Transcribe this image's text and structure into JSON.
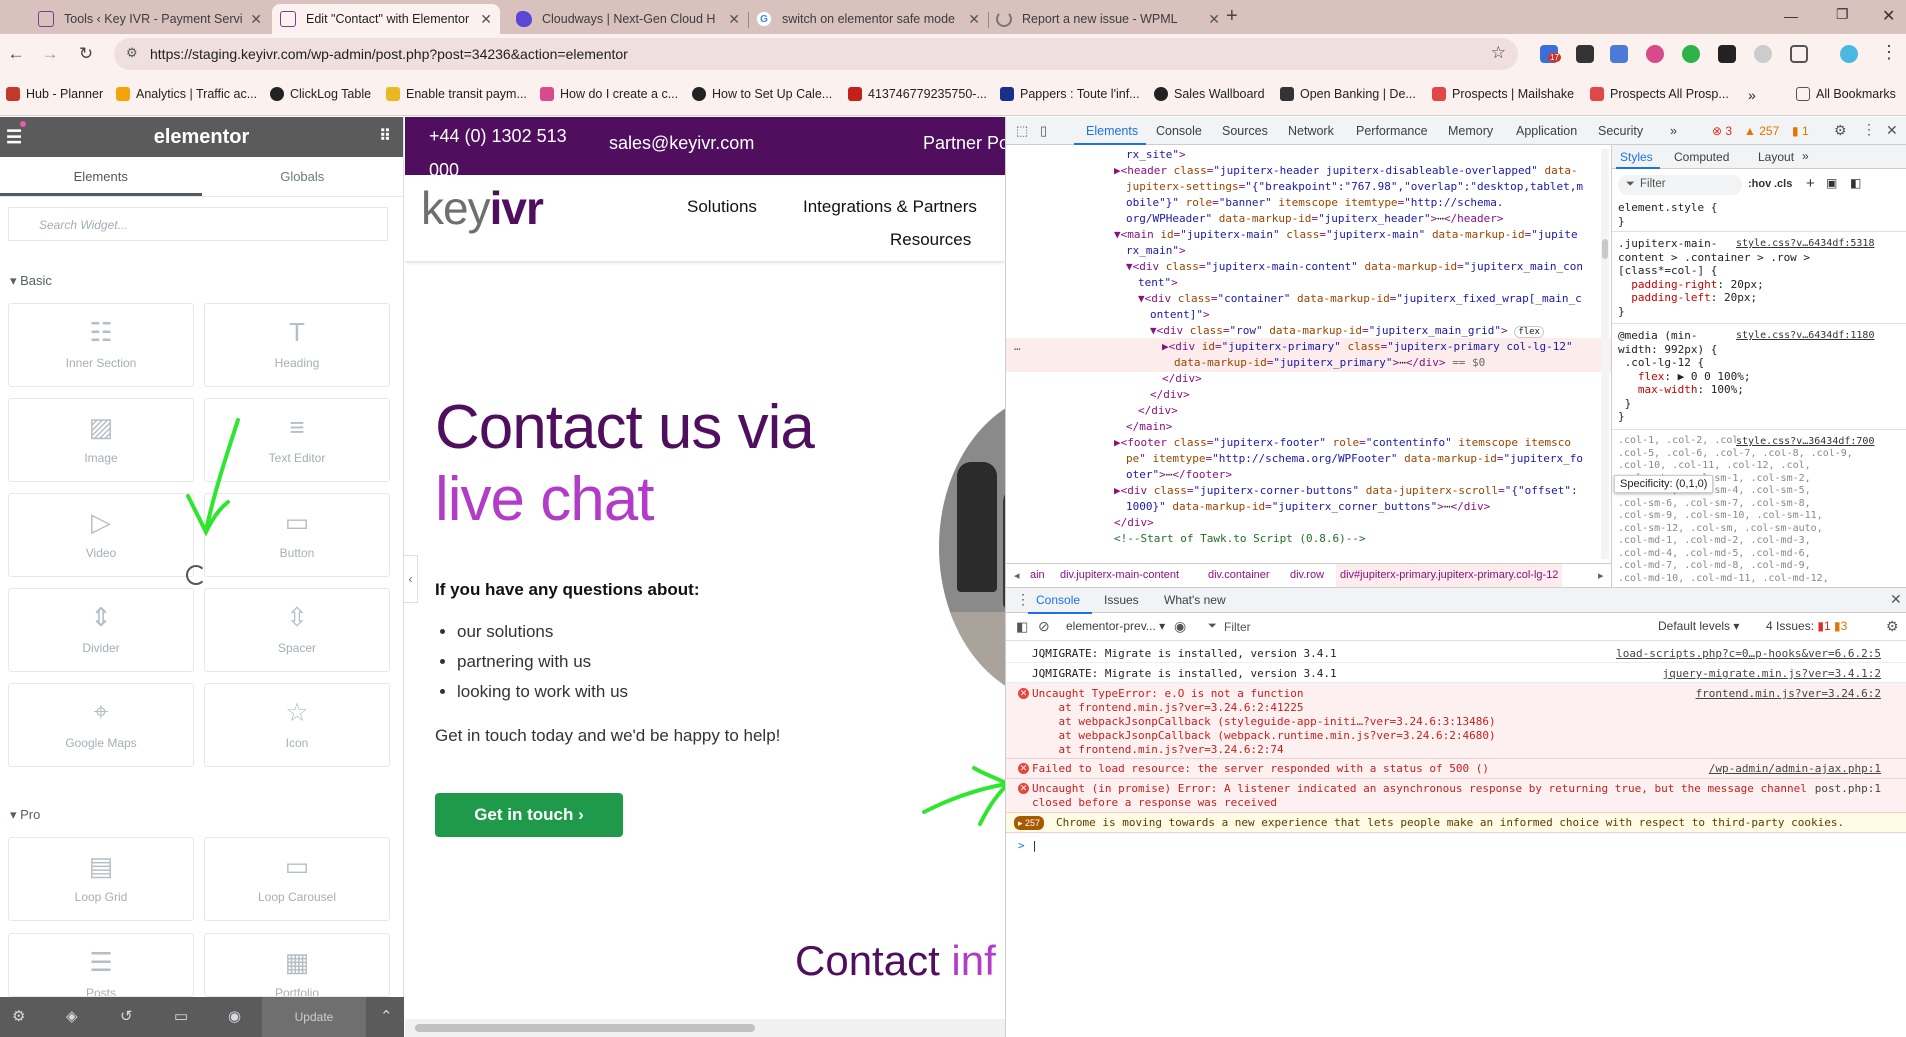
{
  "browser": {
    "tabs": [
      {
        "title": "Tools ‹ Key IVR - Payment Servic",
        "icon": "shield-icon"
      },
      {
        "title": "Edit \"Contact\" with Elementor",
        "icon": "shield-icon"
      },
      {
        "title": "Cloudways | Next-Gen Cloud H",
        "icon": "cloud-icon"
      },
      {
        "title": "switch on elementor safe mode",
        "icon": "google-icon"
      },
      {
        "title": "Report a new issue - WPML",
        "icon": "spinner-icon"
      }
    ],
    "new_tab": "+",
    "url": "https://staging.keyivr.com/wp-admin/post.php?post=34236&action=elementor",
    "ext_badge": "17",
    "bookmarks": [
      "Hub - Planner",
      "Analytics | Traffic ac...",
      "ClickLog Table",
      "Enable transit paym...",
      "How do I create a c...",
      "How to Set Up Cale...",
      "413746779235750-...",
      "Pappers : Toute l'inf...",
      "Sales Wallboard",
      "Open Banking | De...",
      "Prospects | Mailshake",
      "Prospects All Prosp..."
    ],
    "bookmarks_more": "»",
    "all_bookmarks": "All Bookmarks"
  },
  "elementor": {
    "logo": "elementor",
    "tabs": [
      "Elements",
      "Globals"
    ],
    "search_placeholder": "Search Widget...",
    "basic_title": "Basic",
    "pro_title": "Pro",
    "basic_widgets": [
      "Inner Section",
      "Heading",
      "Image",
      "Text Editor",
      "Video",
      "Button",
      "Divider",
      "Spacer",
      "Google Maps",
      "Icon"
    ],
    "pro_widgets": [
      "Loop Grid",
      "Loop Carousel",
      "Posts",
      "Portfolio"
    ],
    "update_label": "Update"
  },
  "site": {
    "phone": "+44 (0) 1302 513 000",
    "email": "sales@keyivr.com",
    "partner": "Partner Po",
    "logo_key": "key",
    "logo_ivr": "ivr",
    "nav": [
      "Solutions",
      "Integrations & Partners",
      "Resources"
    ],
    "heading_line1": "Contact us via",
    "heading_line2": "live chat",
    "subheading": "If you have any questions about:",
    "bullets": [
      "our solutions",
      "partnering with us",
      "looking to work with us"
    ],
    "body": "Get in touch today and we'd be happy to help!",
    "cta": "Get in touch",
    "contact_a": "Contact ",
    "contact_b": "inf"
  },
  "devtools": {
    "tabs": [
      "Elements",
      "Console",
      "Sources",
      "Network",
      "Performance",
      "Memory",
      "Application",
      "Security"
    ],
    "more": "»",
    "err_count": "3",
    "warn_count": "257",
    "issue_count": "1",
    "style_tabs": [
      "Styles",
      "Computed",
      "Layout"
    ],
    "filter": "Filter",
    "hov": ":hov",
    "cls": ".cls",
    "breadcrumbs": [
      "ain",
      "div.jupiterx-main-content",
      "div.container",
      "div.row",
      "div#jupiterx-primary.jupiterx-primary.col-lg-12"
    ],
    "tooltip": "Specificity: (0,1,0)",
    "console_tabs": [
      "Console",
      "Issues",
      "What's new"
    ],
    "context": "elementor-prev...",
    "levels": "Default levels",
    "issues": "4 Issues:",
    "issues_err": "1",
    "issues_warn": "3",
    "console": [
      {
        "kind": "info",
        "text": "JQMIGRATE: Migrate is installed, version 3.4.1",
        "src": "load-scripts.php?c=0…p-hooks&ver=6.6.2:5"
      },
      {
        "kind": "info",
        "text": "JQMIGRATE: Migrate is installed, version 3.4.1",
        "src": "jquery-migrate.min.js?ver=3.4.1:2"
      },
      {
        "kind": "error",
        "text": "Uncaught TypeError: e.O is not a function\n    at frontend.min.js?ver=3.24.6:2:41225\n    at webpackJsonpCallback (styleguide-app-initi…?ver=3.24.6:3:13486)\n    at webpackJsonpCallback (webpack.runtime.min.js?ver=3.24.6:2:4680)\n    at frontend.min.js?ver=3.24.6:2:74",
        "src": "frontend.min.js?ver=3.24.6:2"
      },
      {
        "kind": "error",
        "text": "Failed to load resource: the server responded with a status of 500 ()",
        "src": "/wp-admin/admin-ajax.php:1"
      },
      {
        "kind": "error",
        "text": "Uncaught (in promise) Error: A listener indicated an asynchronous response by returning true, but the message channel\nclosed before a response was received",
        "src": "post.php:1"
      },
      {
        "kind": "warn",
        "badge": "257",
        "text": "Chrome is moving towards a new experience that lets people make an informed choice with respect to third-party cookies.",
        "src": ""
      }
    ],
    "prompt": ">"
  },
  "colors": {
    "brand_purple": "#4f0e5e",
    "accent_purple": "#b23cc7",
    "cta_green": "#1f9a4a",
    "annotation_green": "#2ee62e"
  }
}
